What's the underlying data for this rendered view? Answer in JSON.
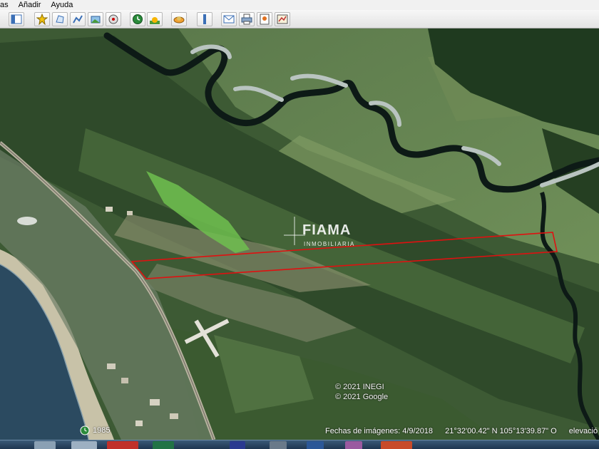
{
  "menu": {
    "items": [
      "as",
      "Añadir",
      "Ayuda"
    ]
  },
  "toolbar": {
    "buttons": [
      {
        "name": "sidebar-toggle-button",
        "icon": "sidebar-icon"
      },
      {
        "name": "add-placemark-button",
        "icon": "pushpin-icon"
      },
      {
        "name": "add-polygon-button",
        "icon": "polygon-icon"
      },
      {
        "name": "add-path-button",
        "icon": "path-icon"
      },
      {
        "name": "add-overlay-button",
        "icon": "image-overlay-icon"
      },
      {
        "name": "record-tour-button",
        "icon": "tour-icon"
      },
      {
        "name": "historical-imagery-button",
        "icon": "clock-icon"
      },
      {
        "name": "sunlight-button",
        "icon": "sun-icon"
      },
      {
        "name": "switch-planet-button",
        "icon": "planet-icon"
      },
      {
        "name": "ruler-button",
        "icon": "ruler-icon"
      },
      {
        "name": "email-button",
        "icon": "envelope-icon"
      },
      {
        "name": "print-button",
        "icon": "printer-icon"
      },
      {
        "name": "save-image-button",
        "icon": "save-image-icon"
      },
      {
        "name": "view-maps-button",
        "icon": "map-icon"
      }
    ]
  },
  "map": {
    "watermark": {
      "brand": "FIAMA",
      "subtitle": "INMOBILIARIA"
    },
    "copyright": [
      "© 2021 INEGI",
      "© 2021 Google"
    ],
    "boundary_color": "#e01010"
  },
  "status": {
    "year": "1985",
    "imagery_date": "Fechas de imágenes: 4/9/2018",
    "coordinates": "21°32'00.42\" N  105°13'39.87\" O",
    "elevation": "elevació"
  },
  "colors": {
    "accent": "#e01010",
    "toolbar_bg": "#e8e8e8",
    "taskbar": "#1e3550"
  }
}
